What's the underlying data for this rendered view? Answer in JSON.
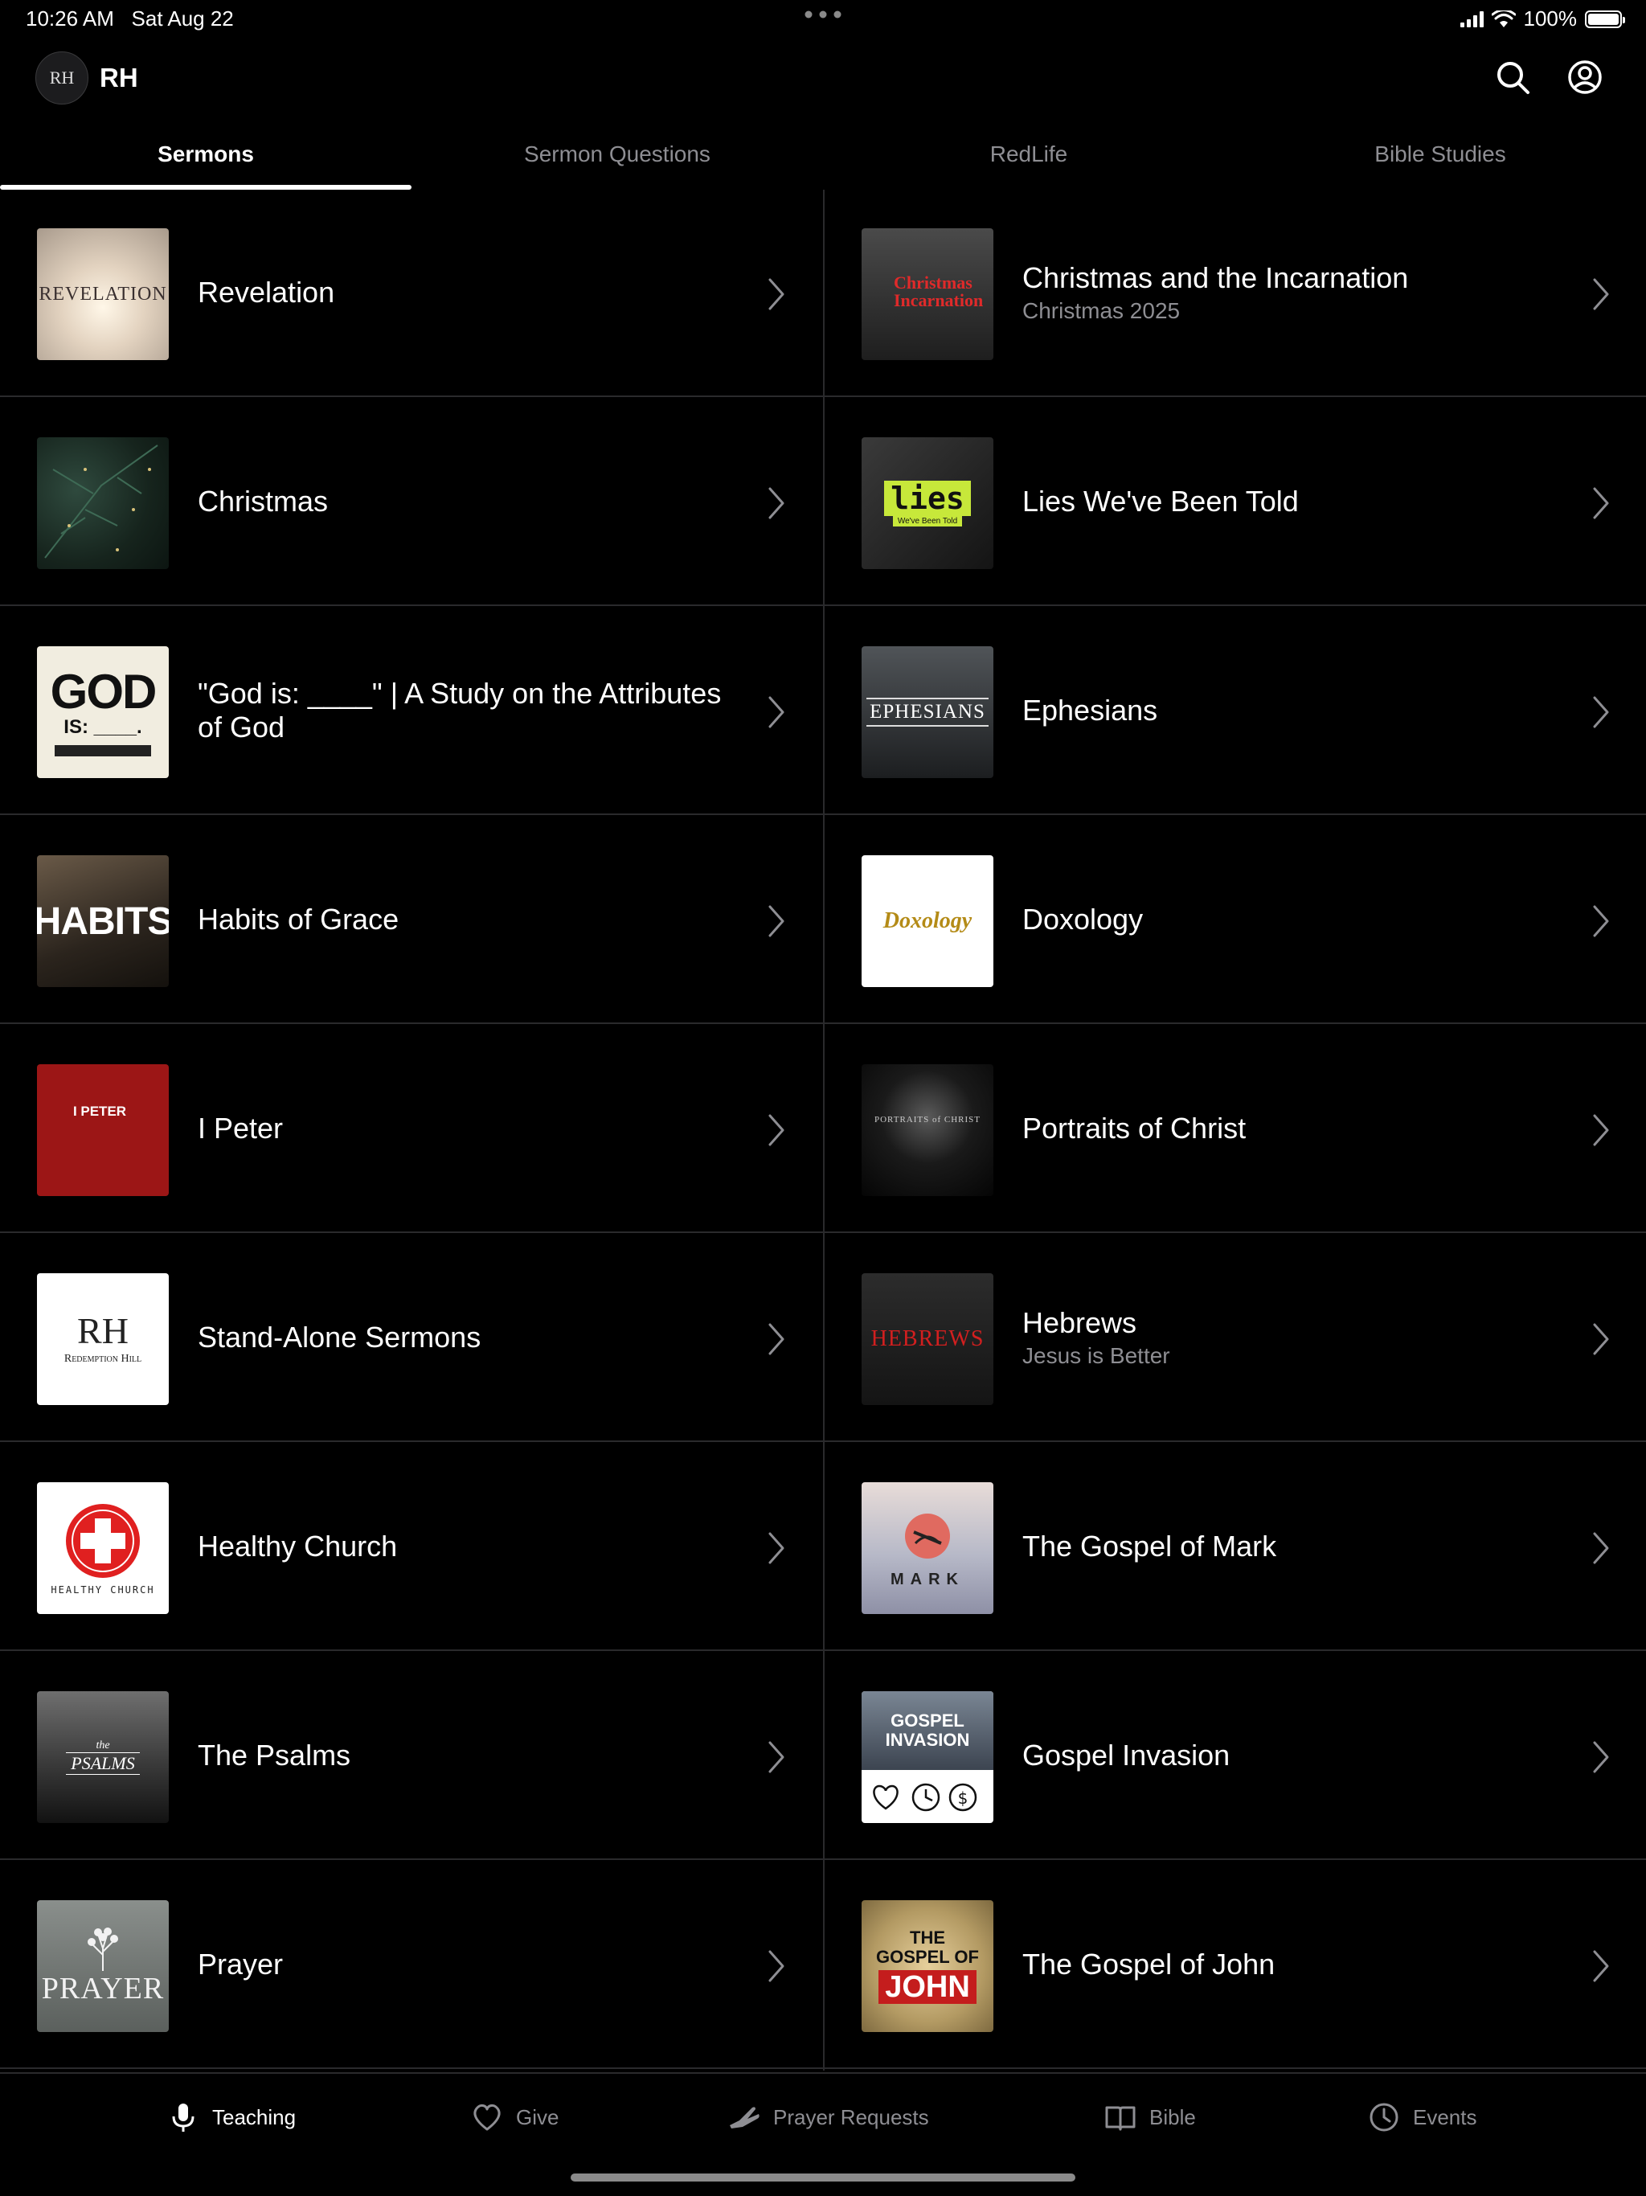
{
  "status_bar": {
    "time": "10:26 AM",
    "date": "Sat Aug 22",
    "battery": "100%"
  },
  "header": {
    "logo_text": "RH",
    "title": "RH",
    "search_icon": "search-icon",
    "account_icon": "account-icon"
  },
  "tabs": [
    {
      "label": "Sermons",
      "active": true
    },
    {
      "label": "Sermon Questions",
      "active": false
    },
    {
      "label": "RedLife",
      "active": false
    },
    {
      "label": "Bible Studies",
      "active": false
    }
  ],
  "series": [
    {
      "title": "Revelation",
      "subtitle": "",
      "thumb_text": "REVELATION"
    },
    {
      "title": "Christmas and the Incarnation",
      "subtitle": "Christmas 2025",
      "thumb_text": "Christmas Incarnation"
    },
    {
      "title": "Christmas",
      "subtitle": "",
      "thumb_text": ""
    },
    {
      "title": "Lies We've Been Told",
      "subtitle": "",
      "thumb_text": "lies",
      "thumb_sub": "We've Been Told"
    },
    {
      "title": "\"God is: ____\" | A Study on the Attributes of God",
      "subtitle": "",
      "thumb_text": "GOD",
      "thumb_sub": "IS: ____."
    },
    {
      "title": "Ephesians",
      "subtitle": "",
      "thumb_text": "EPHESIANS"
    },
    {
      "title": "Habits of Grace",
      "subtitle": "",
      "thumb_text": "HABITS"
    },
    {
      "title": "Doxology",
      "subtitle": "",
      "thumb_text": "Doxology"
    },
    {
      "title": "I Peter",
      "subtitle": "",
      "thumb_text": "I PETER"
    },
    {
      "title": "Portraits of Christ",
      "subtitle": "",
      "thumb_text": "PORTRAITS of CHRIST"
    },
    {
      "title": "Stand-Alone Sermons",
      "subtitle": "",
      "thumb_text": "RH",
      "thumb_sub": "Redemption Hill"
    },
    {
      "title": "Hebrews",
      "subtitle": "Jesus is Better",
      "thumb_text": "HEBREWS"
    },
    {
      "title": "Healthy Church",
      "subtitle": "",
      "thumb_text": "HEALTHY CHURCH"
    },
    {
      "title": "The Gospel of Mark",
      "subtitle": "",
      "thumb_text": "MARK"
    },
    {
      "title": "The Psalms",
      "subtitle": "",
      "thumb_text": "the",
      "thumb_sub": "PSALMS"
    },
    {
      "title": "Gospel Invasion",
      "subtitle": "",
      "thumb_text": "GOSPEL INVASION"
    },
    {
      "title": "Prayer",
      "subtitle": "",
      "thumb_text": "PRAYER"
    },
    {
      "title": "The Gospel of John",
      "subtitle": "",
      "thumb_text": "THE GOSPEL OF",
      "thumb_sub": "JOHN"
    }
  ],
  "tabbar": [
    {
      "label": "Teaching",
      "icon": "microphone-icon",
      "active": true
    },
    {
      "label": "Give",
      "icon": "heart-icon",
      "active": false
    },
    {
      "label": "Prayer Requests",
      "icon": "praying-hands-icon",
      "active": false
    },
    {
      "label": "Bible",
      "icon": "book-icon",
      "active": false
    },
    {
      "label": "Events",
      "icon": "clock-icon",
      "active": false
    }
  ],
  "colors": {
    "background": "#000000",
    "divider": "#2a2a2c",
    "muted_text": "#8e8e93",
    "active_text": "#ffffff"
  }
}
